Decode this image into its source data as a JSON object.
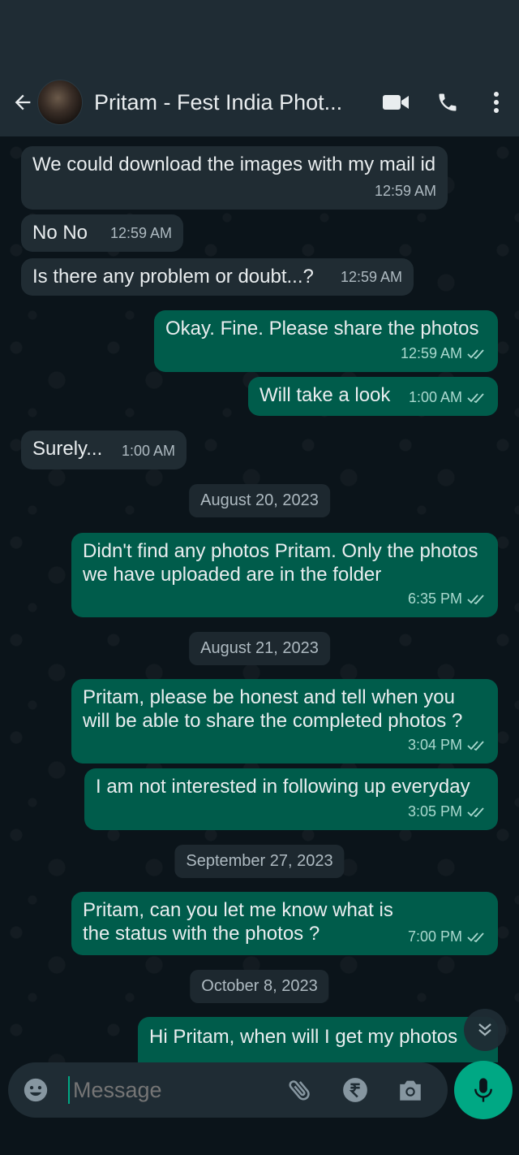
{
  "header": {
    "contact_name": "Pritam - Fest India Phot...",
    "icons": [
      "back-arrow-icon",
      "avatar",
      "video-call-icon",
      "phone-icon",
      "more-vert-icon"
    ]
  },
  "messages": [
    {
      "dir": "in",
      "text": "We could download the images with my mail id",
      "time": "12:59 AM"
    },
    {
      "dir": "in",
      "text": "No No",
      "time": "12:59 AM"
    },
    {
      "dir": "in",
      "text": "Is there any problem or doubt...?",
      "time": "12:59 AM"
    },
    {
      "dir": "out",
      "text": "Okay. Fine. Please share the photos",
      "time": "12:59 AM"
    },
    {
      "dir": "out",
      "text": "Will take a look",
      "time": "1:00 AM"
    },
    {
      "dir": "in",
      "text": "Surely...",
      "time": "1:00 AM"
    },
    {
      "date": "August 20, 2023"
    },
    {
      "dir": "out",
      "text": "Didn't find any photos Pritam. Only the photos we have uploaded are in the folder",
      "time": "6:35 PM"
    },
    {
      "date": "August 21, 2023"
    },
    {
      "dir": "out",
      "text": "Pritam, please be honest and tell when you will be able to share the completed photos ?",
      "time": "3:04 PM"
    },
    {
      "dir": "out",
      "text": "I am not interested in following up everyday",
      "time": "3:05 PM"
    },
    {
      "date": "September 27, 2023"
    },
    {
      "dir": "out",
      "text": "Pritam, can you let me know what is the status with the photos ?",
      "time": "7:00 PM"
    },
    {
      "date": "October 8, 2023"
    },
    {
      "dir": "out",
      "text": "Hi Pritam, when will I get my photos",
      "time": ""
    }
  ],
  "input": {
    "placeholder": "Message",
    "icons": [
      "emoji-icon",
      "attach-icon",
      "rupee-payment-icon",
      "camera-icon"
    ]
  },
  "colors": {
    "background": "#0b141a",
    "header": "#1f2c34",
    "incoming_bubble": "#202c33",
    "outgoing_bubble": "#005c4b",
    "accent": "#00a884"
  }
}
